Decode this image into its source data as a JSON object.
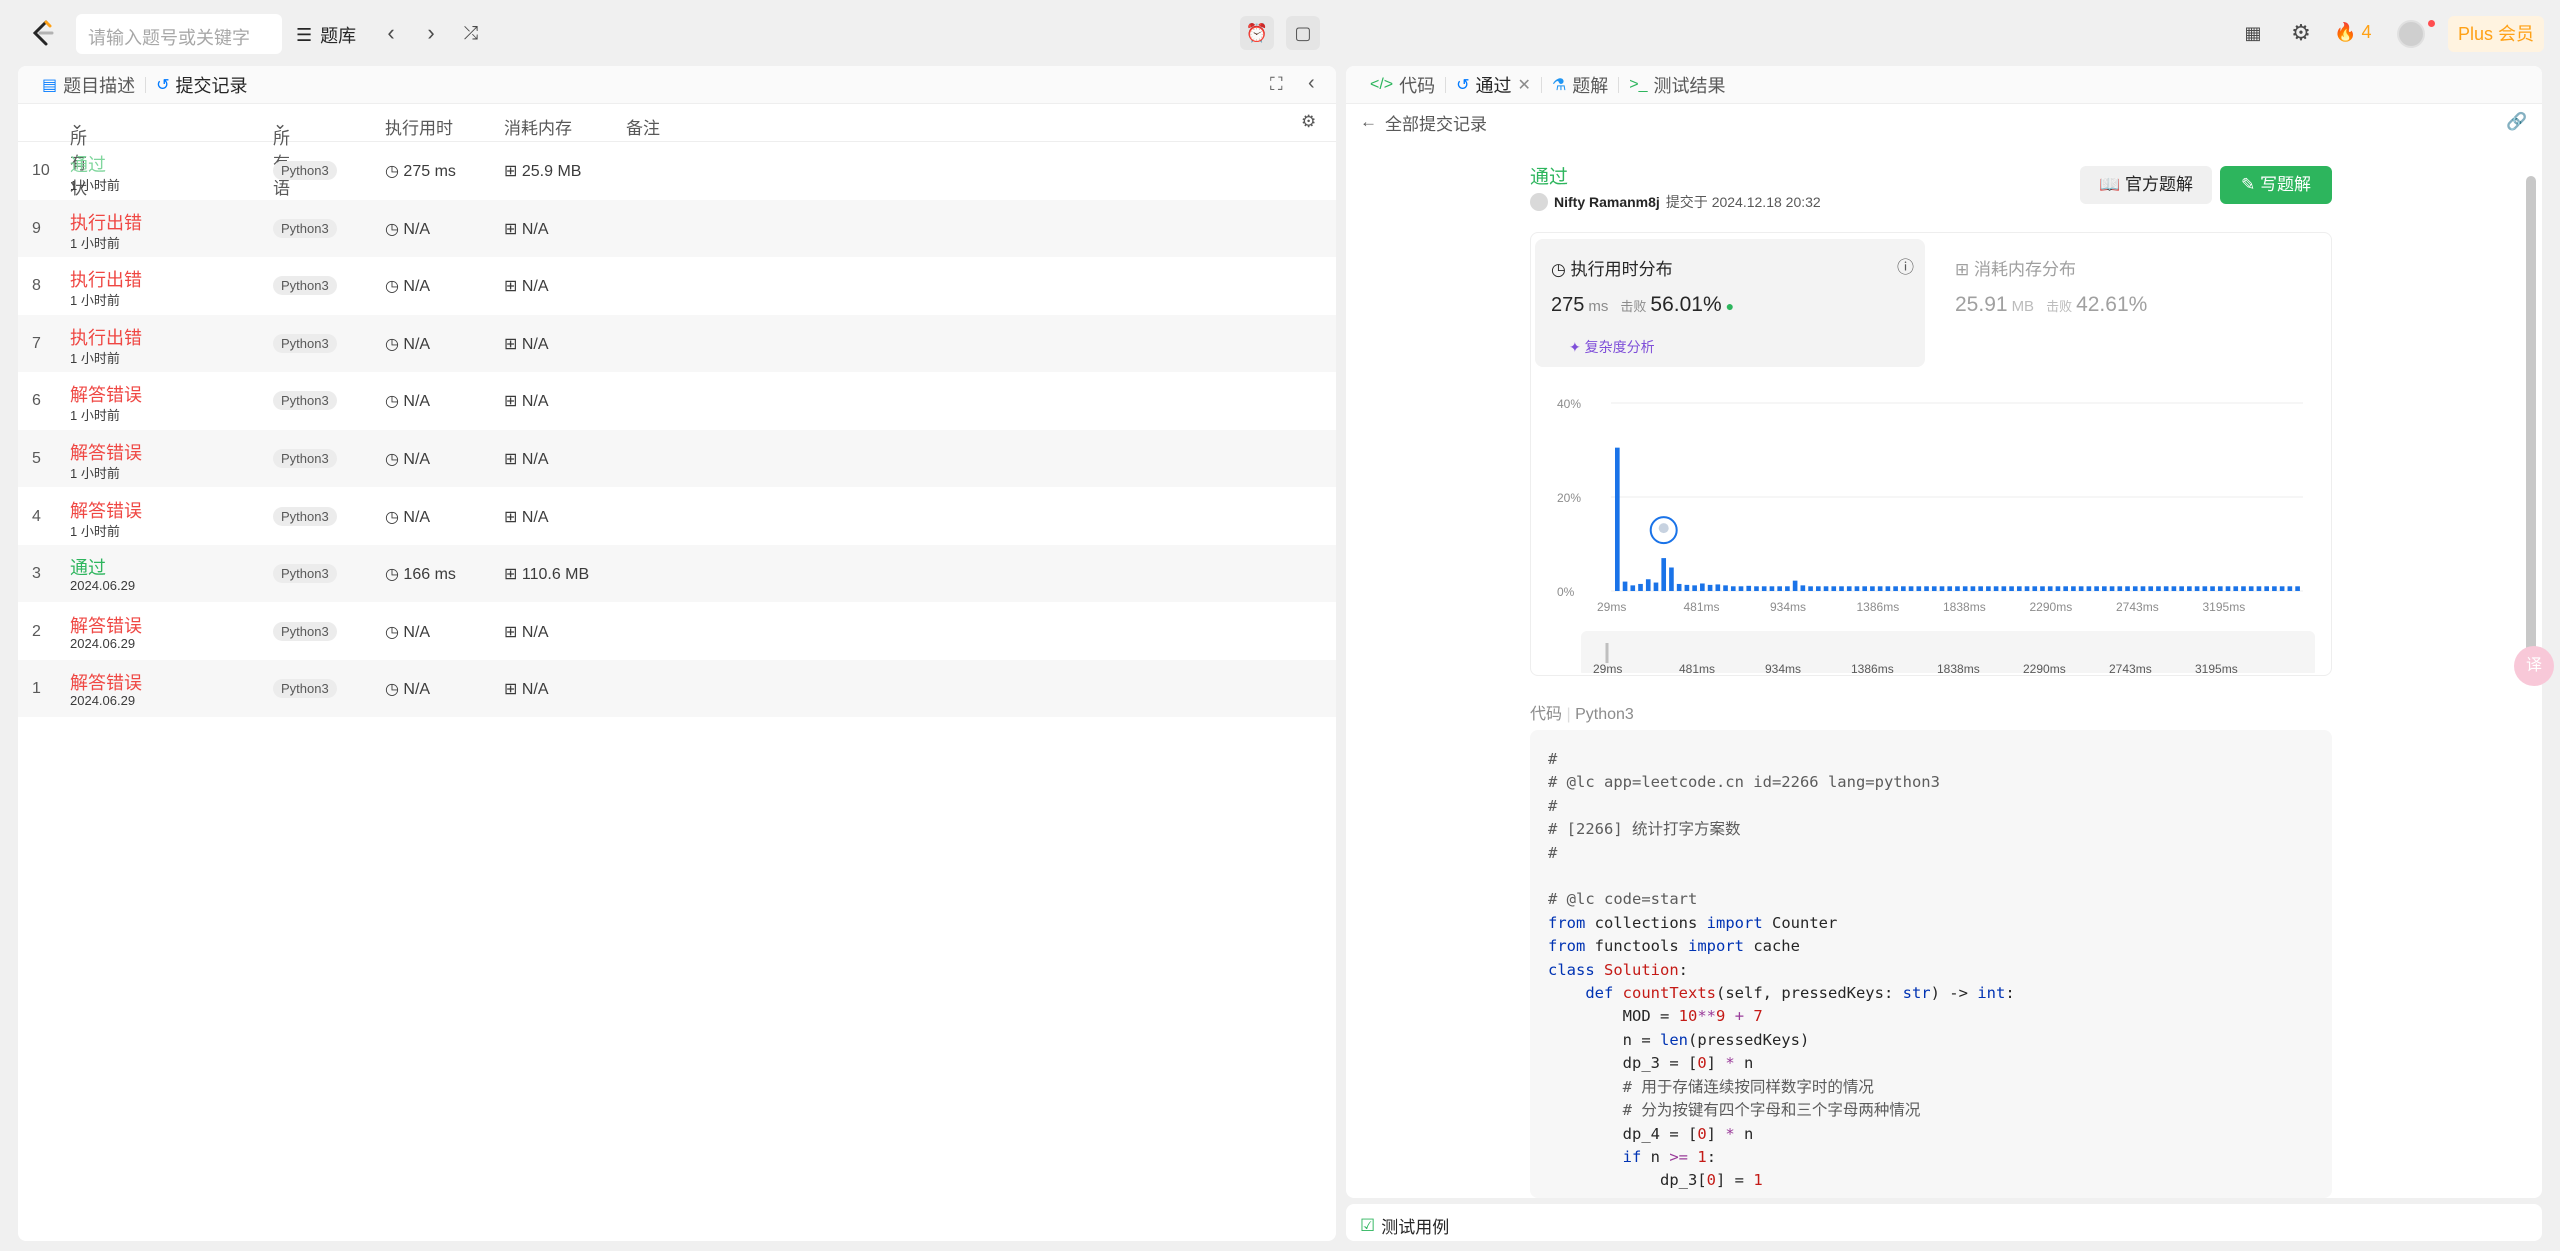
{
  "topbar": {
    "search_placeholder": "请输入题号或关键字",
    "problem_bank": "题库",
    "streak": "4",
    "plus": "Plus 会员"
  },
  "left": {
    "tabs": [
      "题目描述",
      "提交记录"
    ],
    "columns": [
      "所有状态",
      "所有语言",
      "执行用时",
      "消耗内存",
      "备注"
    ],
    "rows": [
      {
        "idx": "10",
        "status": "通过",
        "kind": "ok-light",
        "time": "1 小时前",
        "lang": "Python3",
        "runtime": "275 ms",
        "memory": "25.9 MB"
      },
      {
        "idx": "9",
        "status": "执行出错",
        "kind": "err",
        "time": "1 小时前",
        "lang": "Python3",
        "runtime": "N/A",
        "memory": "N/A"
      },
      {
        "idx": "8",
        "status": "执行出错",
        "kind": "err",
        "time": "1 小时前",
        "lang": "Python3",
        "runtime": "N/A",
        "memory": "N/A"
      },
      {
        "idx": "7",
        "status": "执行出错",
        "kind": "err",
        "time": "1 小时前",
        "lang": "Python3",
        "runtime": "N/A",
        "memory": "N/A"
      },
      {
        "idx": "6",
        "status": "解答错误",
        "kind": "err",
        "time": "1 小时前",
        "lang": "Python3",
        "runtime": "N/A",
        "memory": "N/A"
      },
      {
        "idx": "5",
        "status": "解答错误",
        "kind": "err",
        "time": "1 小时前",
        "lang": "Python3",
        "runtime": "N/A",
        "memory": "N/A"
      },
      {
        "idx": "4",
        "status": "解答错误",
        "kind": "err",
        "time": "1 小时前",
        "lang": "Python3",
        "runtime": "N/A",
        "memory": "N/A"
      },
      {
        "idx": "3",
        "status": "通过",
        "kind": "ok",
        "time": "2024.06.29",
        "lang": "Python3",
        "runtime": "166 ms",
        "memory": "110.6 MB"
      },
      {
        "idx": "2",
        "status": "解答错误",
        "kind": "err",
        "time": "2024.06.29",
        "lang": "Python3",
        "runtime": "N/A",
        "memory": "N/A"
      },
      {
        "idx": "1",
        "status": "解答错误",
        "kind": "err",
        "time": "2024.06.29",
        "lang": "Python3",
        "runtime": "N/A",
        "memory": "N/A"
      }
    ]
  },
  "right": {
    "tabs": [
      "代码",
      "通过",
      "题解",
      "测试结果"
    ],
    "back_label": "全部提交记录",
    "result": "通过",
    "author": "Nifty Ramanm8j",
    "submitted_at": "提交于 2024.12.18 20:32",
    "btn_official": "官方题解",
    "btn_write": "写题解",
    "runtime_title": "执行用时分布",
    "runtime_value": "275",
    "runtime_unit": "ms",
    "beat_label": "击败",
    "runtime_pct": "56.01%",
    "complexity": "复杂度分析",
    "memory_title": "消耗内存分布",
    "memory_value": "25.91",
    "memory_unit": "MB",
    "memory_pct": "42.61%",
    "code_label": "代码",
    "code_lang": "Python3",
    "bottom_tab": "测试用例",
    "fanyi": "译"
  },
  "chart_data": {
    "type": "bar",
    "yticks": [
      "40%",
      "20%",
      "0%"
    ],
    "ylim": [
      0,
      40
    ],
    "xticks": [
      "29ms",
      "481ms",
      "934ms",
      "1386ms",
      "1838ms",
      "2290ms",
      "2743ms",
      "3195ms"
    ],
    "values": [
      30.5,
      2.0,
      1.2,
      1.5,
      2.5,
      1.8,
      7.0,
      5.0,
      1.5,
      1.3,
      1.2,
      1.6,
      1.3,
      1.4,
      1.2,
      1.0,
      1.0,
      1.1,
      1.0,
      1.0,
      1.0,
      1.0,
      1.0,
      2.2,
      1.2,
      1.0,
      1.0,
      1.0,
      1.0,
      1.0,
      1.0,
      1.0,
      1.0,
      1.0,
      1.0,
      1.0,
      1.0,
      1.0,
      1.0,
      1.0,
      1.0,
      1.0,
      1.0,
      1.0,
      1.0,
      1.0,
      1.0,
      1.0,
      1.0,
      1.0,
      1.0,
      1.0,
      1.0,
      1.0,
      1.0,
      1.0,
      1.0,
      1.0,
      1.0,
      1.0,
      1.0,
      1.0,
      1.0,
      1.0,
      1.0,
      1.0,
      1.0,
      1.0,
      1.0,
      1.0,
      1.0,
      1.0,
      1.0,
      1.0,
      1.0,
      1.0,
      1.0,
      1.0,
      1.0,
      1.0,
      1.0,
      1.0,
      1.0,
      1.0,
      1.0,
      1.0,
      1.0,
      1.0,
      1.0
    ],
    "user_bar_index": 6,
    "bar_color": "#1a73e8"
  }
}
